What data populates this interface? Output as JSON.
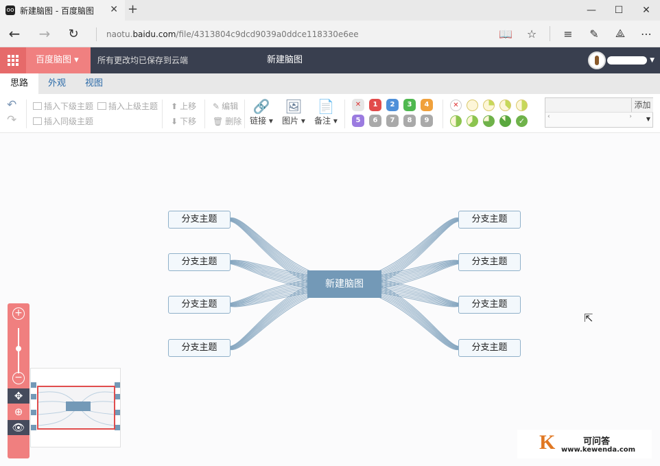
{
  "browser": {
    "tab_title": "新建脑图 - 百度脑图",
    "favicon": "oo",
    "url_prefix": "naotu.",
    "url_domain": "baidu.com",
    "url_path": "/file/4313804c9dcd9039a0ddce118330e6ee"
  },
  "app": {
    "brand": "百度脑图 ▾",
    "save_status": "所有更改均已保存到云端",
    "doc_title": "新建脑图"
  },
  "tabs": [
    "思路",
    "外观",
    "视图"
  ],
  "toolbar": {
    "insert_child": "插入下级主题",
    "insert_parent": "插入上级主题",
    "insert_sibling": "插入同级主题",
    "move_up": "上移",
    "move_down": "下移",
    "edit": "编辑",
    "delete": "删除",
    "link": "链接 ▾",
    "image": "图片 ▾",
    "note": "备注 ▾",
    "priorities": [
      {
        "label": "✕",
        "color": "#e6e6e6",
        "fg": "#d33"
      },
      {
        "label": "1",
        "color": "#e24b4b",
        "fg": "#fff"
      },
      {
        "label": "2",
        "color": "#4e8fd9",
        "fg": "#fff"
      },
      {
        "label": "3",
        "color": "#4fb84f",
        "fg": "#fff"
      },
      {
        "label": "4",
        "color": "#f0a13c",
        "fg": "#fff"
      },
      {
        "label": "5",
        "color": "#9b7be0",
        "fg": "#fff"
      },
      {
        "label": "6",
        "color": "#a9a9a9",
        "fg": "#fff"
      },
      {
        "label": "7",
        "color": "#a9a9a9",
        "fg": "#fff"
      },
      {
        "label": "8",
        "color": "#a9a9a9",
        "fg": "#fff"
      },
      {
        "label": "9",
        "color": "#a9a9a9",
        "fg": "#fff"
      }
    ],
    "resource_add": "添加"
  },
  "mindmap": {
    "root": "新建脑图",
    "left_branches": [
      "分支主题",
      "分支主题",
      "分支主题",
      "分支主题"
    ],
    "right_branches": [
      "分支主题",
      "分支主题",
      "分支主题",
      "分支主题"
    ],
    "line_color": "#6f95b4"
  },
  "watermark": {
    "logo": "K",
    "name": "可问答",
    "url": "www.kewenda.com"
  }
}
